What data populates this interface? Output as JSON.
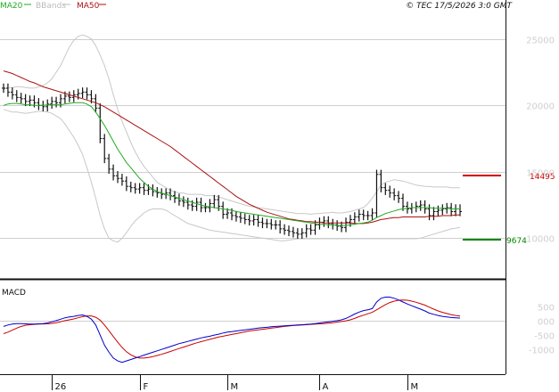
{
  "header": {
    "legend": [
      {
        "label": "MA20",
        "color": "#22aa22"
      },
      {
        "label": "BBands",
        "color": "#bbbbbb"
      },
      {
        "label": "MA50",
        "color": "#aa1111"
      }
    ],
    "credit": "© TEC 17/5/2026 3:0 GMT"
  },
  "chart_data": [
    {
      "type": "line",
      "subtype": "candlestick-bars with indicators",
      "y_ticks": [
        10000,
        15000,
        20000,
        25000
      ],
      "y_tick_labels": [
        "10000",
        "15000",
        "20000",
        "25000"
      ],
      "ylim": [
        7000,
        27000
      ],
      "grid": true,
      "x_labels": [
        "26",
        "F",
        "M",
        "A",
        "M"
      ],
      "x_label_index": [
        11,
        31,
        51,
        72,
        92
      ],
      "n_bars": 105,
      "levels": [
        {
          "label": "14495",
          "value": 14495,
          "color": "#cc0000"
        },
        {
          "label": "9674",
          "value": 9674,
          "color": "#008800"
        }
      ],
      "price_close": [
        21300,
        21000,
        20800,
        20600,
        20500,
        20300,
        20400,
        20200,
        20000,
        19900,
        20100,
        20300,
        20200,
        20500,
        20700,
        20600,
        20800,
        20900,
        21000,
        20800,
        20500,
        19800,
        17500,
        16000,
        15200,
        14700,
        14500,
        14300,
        13900,
        13800,
        13700,
        13800,
        13600,
        13700,
        13500,
        13400,
        13300,
        13400,
        13200,
        13000,
        12800,
        12700,
        12500,
        12400,
        12700,
        12300,
        12300,
        12600,
        12900,
        12400,
        11800,
        11900,
        11700,
        11600,
        11500,
        11400,
        11300,
        11400,
        11200,
        11100,
        11100,
        11000,
        11000,
        10700,
        10600,
        10500,
        10400,
        10300,
        10400,
        10700,
        10600,
        11000,
        11200,
        11300,
        11100,
        11000,
        10900,
        10800,
        11200,
        11400,
        11600,
        11800,
        11700,
        11700,
        11900,
        14800,
        13800,
        13600,
        13400,
        13200,
        13000,
        12400,
        12200,
        12300,
        12400,
        12500,
        12200,
        11700,
        12000,
        12100,
        12200,
        12300,
        12000,
        12200,
        12000
      ],
      "ma20": [
        20000,
        20100,
        20150,
        20150,
        20100,
        20050,
        20050,
        20000,
        20000,
        20000,
        20050,
        20050,
        20050,
        20050,
        20100,
        20150,
        20200,
        20200,
        20200,
        20100,
        19900,
        19500,
        19000,
        18500,
        17900,
        17300,
        16700,
        16200,
        15700,
        15300,
        14900,
        14500,
        14200,
        13900,
        13700,
        13500,
        13400,
        13300,
        13200,
        13100,
        13000,
        12900,
        12800,
        12700,
        12600,
        12500,
        12400,
        12350,
        12300,
        12250,
        12200,
        12150,
        12100,
        12000,
        11950,
        11900,
        11850,
        11800,
        11750,
        11700,
        11650,
        11600,
        11550,
        11500,
        11450,
        11400,
        11350,
        11300,
        11250,
        11200,
        11150,
        11100,
        11050,
        11050,
        11000,
        11000,
        10950,
        10950,
        10950,
        11000,
        11050,
        11100,
        11150,
        11200,
        11350,
        11550,
        11700,
        11850,
        11950,
        12050,
        12150,
        12200,
        12250,
        12300,
        12300,
        12300,
        12300,
        12300,
        12250,
        12250,
        12250,
        12250,
        12200,
        12200,
        12200
      ],
      "ma50": [
        22600,
        22500,
        22400,
        22250,
        22100,
        21950,
        21800,
        21700,
        21550,
        21400,
        21300,
        21200,
        21100,
        21000,
        20900,
        20800,
        20700,
        20600,
        20500,
        20400,
        20300,
        20200,
        20050,
        19900,
        19700,
        19500,
        19300,
        19100,
        18900,
        18700,
        18500,
        18300,
        18100,
        17900,
        17700,
        17500,
        17300,
        17100,
        16900,
        16650,
        16400,
        16150,
        15900,
        15650,
        15400,
        15150,
        14900,
        14650,
        14400,
        14150,
        13900,
        13650,
        13400,
        13150,
        12950,
        12750,
        12550,
        12400,
        12250,
        12100,
        11950,
        11850,
        11750,
        11650,
        11550,
        11450,
        11400,
        11350,
        11300,
        11250,
        11250,
        11200,
        11200,
        11150,
        11150,
        11150,
        11150,
        11150,
        11150,
        11150,
        11100,
        11100,
        11100,
        11150,
        11200,
        11300,
        11400,
        11450,
        11500,
        11550,
        11550,
        11600,
        11600,
        11600,
        11600,
        11600,
        11600,
        11650,
        11650,
        11650,
        11700,
        11700,
        11700,
        11750,
        11750
      ],
      "bb_upper": [
        21200,
        21300,
        21350,
        21400,
        21400,
        21350,
        21300,
        21300,
        21400,
        21500,
        21700,
        22000,
        22500,
        23000,
        23700,
        24400,
        24900,
        25200,
        25300,
        25200,
        25000,
        24500,
        23800,
        23000,
        22000,
        20800,
        19700,
        18800,
        18000,
        17200,
        16500,
        15900,
        15400,
        15000,
        14600,
        14200,
        14000,
        13800,
        13600,
        13500,
        13400,
        13400,
        13300,
        13300,
        13300,
        13300,
        13200,
        13200,
        13200,
        13100,
        13000,
        12900,
        12800,
        12700,
        12600,
        12500,
        12400,
        12350,
        12300,
        12250,
        12200,
        12150,
        12100,
        12050,
        12000,
        11950,
        11900,
        11850,
        11850,
        11850,
        11800,
        11850,
        11850,
        11900,
        11900,
        11950,
        11900,
        11900,
        11950,
        12000,
        12100,
        12200,
        12300,
        12600,
        13000,
        13500,
        14000,
        14200,
        14300,
        14400,
        14350,
        14300,
        14200,
        14100,
        14000,
        13950,
        13900,
        13900,
        13850,
        13850,
        13850,
        13850,
        13800,
        13800,
        13800
      ],
      "bb_lower": [
        19700,
        19600,
        19500,
        19500,
        19450,
        19400,
        19450,
        19500,
        19550,
        19550,
        19500,
        19400,
        19200,
        19000,
        18600,
        18100,
        17600,
        17000,
        16300,
        15300,
        14200,
        13000,
        11700,
        10700,
        10000,
        9800,
        9700,
        10000,
        10400,
        10900,
        11300,
        11600,
        11900,
        12100,
        12200,
        12200,
        12200,
        12100,
        11900,
        11700,
        11500,
        11300,
        11100,
        11000,
        10900,
        10800,
        10700,
        10600,
        10550,
        10500,
        10450,
        10400,
        10350,
        10300,
        10250,
        10200,
        10150,
        10100,
        10050,
        10000,
        9950,
        9900,
        9850,
        9800,
        9800,
        9850,
        9900,
        9950,
        9950,
        9950,
        9950,
        9950,
        9950,
        9950,
        9950,
        9950,
        9950,
        9950,
        9950,
        9950,
        9950,
        9950,
        9950,
        9950,
        9950,
        9950,
        9950,
        9950,
        9950,
        9950,
        9950,
        9950,
        9950,
        9950,
        9950,
        10000,
        10100,
        10200,
        10300,
        10400,
        10500,
        10600,
        10700,
        10750,
        10800
      ]
    },
    {
      "type": "line",
      "title": "MACD",
      "y_ticks": [
        500,
        0,
        -500,
        -1000
      ],
      "y_tick_labels": [
        "500",
        "000",
        "-500",
        "-1000"
      ],
      "ylim": [
        -1800,
        1300
      ],
      "grid": true,
      "series": [
        {
          "name": "MACD",
          "color": "#0000cc",
          "values": [
            -200,
            -150,
            -120,
            -100,
            -100,
            -110,
            -120,
            -120,
            -110,
            -100,
            -80,
            -40,
            0,
            50,
            100,
            130,
            150,
            180,
            200,
            150,
            50,
            -150,
            -500,
            -850,
            -1100,
            -1300,
            -1400,
            -1450,
            -1400,
            -1350,
            -1300,
            -1250,
            -1200,
            -1150,
            -1100,
            -1050,
            -1000,
            -950,
            -900,
            -850,
            -800,
            -760,
            -720,
            -680,
            -640,
            -600,
            -570,
            -540,
            -500,
            -470,
            -430,
            -400,
            -380,
            -360,
            -340,
            -320,
            -300,
            -280,
            -260,
            -240,
            -230,
            -210,
            -200,
            -190,
            -180,
            -170,
            -160,
            -150,
            -140,
            -130,
            -120,
            -100,
            -80,
            -60,
            -40,
            -20,
            0,
            30,
            80,
            150,
            230,
            300,
            350,
            380,
            420,
            650,
            780,
            820,
            820,
            780,
            720,
            650,
            580,
            520,
            460,
            400,
            340,
            260,
            220,
            180,
            150,
            130,
            110,
            100,
            90
          ]
        },
        {
          "name": "Signal",
          "color": "#cc0000",
          "values": [
            -450,
            -400,
            -330,
            -260,
            -200,
            -160,
            -140,
            -130,
            -120,
            -115,
            -110,
            -95,
            -70,
            -40,
            0,
            30,
            60,
            100,
            140,
            165,
            165,
            120,
            20,
            -150,
            -350,
            -550,
            -750,
            -930,
            -1080,
            -1190,
            -1260,
            -1300,
            -1300,
            -1280,
            -1250,
            -1210,
            -1170,
            -1120,
            -1070,
            -1020,
            -970,
            -920,
            -870,
            -820,
            -770,
            -730,
            -690,
            -650,
            -610,
            -570,
            -540,
            -510,
            -480,
            -450,
            -420,
            -390,
            -360,
            -340,
            -320,
            -300,
            -280,
            -260,
            -240,
            -220,
            -200,
            -185,
            -170,
            -160,
            -150,
            -140,
            -130,
            -120,
            -110,
            -100,
            -85,
            -70,
            -50,
            -30,
            -5,
            30,
            80,
            140,
            190,
            240,
            290,
            380,
            470,
            560,
            630,
            680,
            710,
            720,
            710,
            680,
            640,
            590,
            540,
            470,
            400,
            340,
            290,
            250,
            210,
            180,
            160
          ]
        }
      ]
    }
  ]
}
